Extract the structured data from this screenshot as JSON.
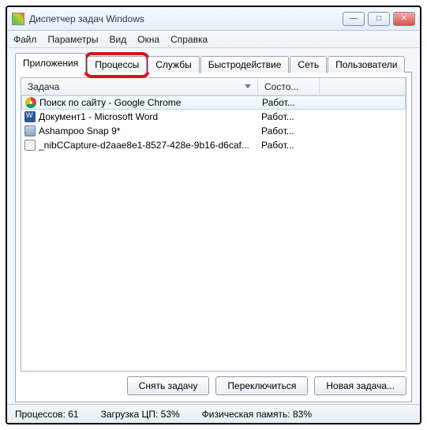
{
  "window": {
    "title": "Диспетчер задач Windows"
  },
  "menu": {
    "file": "Файл",
    "options": "Параметры",
    "view": "Вид",
    "windows": "Окна",
    "help": "Справка"
  },
  "tabs": {
    "apps": "Приложения",
    "processes": "Процессы",
    "services": "Службы",
    "performance": "Быстродействие",
    "network": "Сеть",
    "users": "Пользователи"
  },
  "columns": {
    "task": "Задача",
    "status": "Состо..."
  },
  "rows": [
    {
      "icon": "chrome",
      "task": "Поиск по сайту - Google Chrome",
      "status": "Работ..."
    },
    {
      "icon": "word",
      "task": "Документ1 - Microsoft Word",
      "status": "Работ..."
    },
    {
      "icon": "snap",
      "task": "Ashampoo Snap 9*",
      "status": "Работ..."
    },
    {
      "icon": "capture",
      "task": "_nibCCapture-d2aae8e1-8527-428e-9b16-d6caf...",
      "status": "Работ..."
    }
  ],
  "buttons": {
    "end_task": "Снять задачу",
    "switch_to": "Переключиться",
    "new_task": "Новая задача..."
  },
  "status": {
    "processes": "Процессов: 61",
    "cpu": "Загрузка ЦП: 53%",
    "memory": "Физическая память: 83%"
  }
}
